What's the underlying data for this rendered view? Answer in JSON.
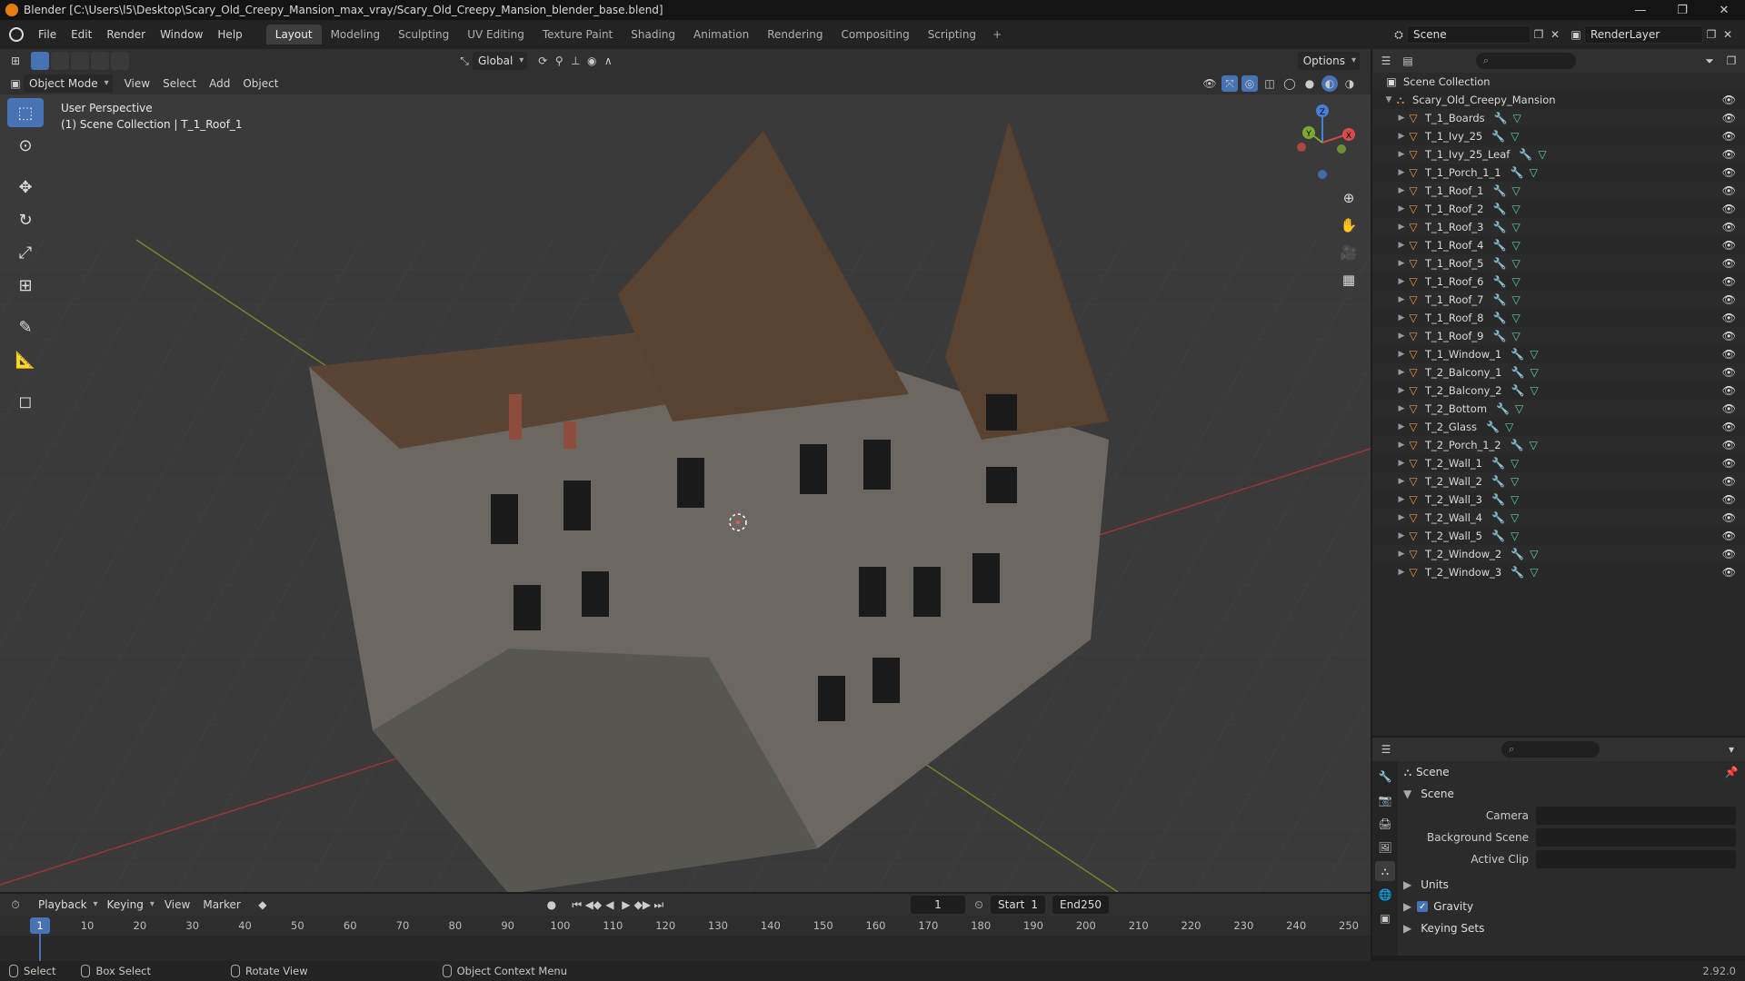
{
  "window": {
    "title": "Blender [C:\\Users\\l5\\Desktop\\Scary_Old_Creepy_Mansion_max_vray/Scary_Old_Creepy_Mansion_blender_base.blend]",
    "controls": [
      "—",
      "❐",
      "✕"
    ]
  },
  "menu": [
    "File",
    "Edit",
    "Render",
    "Window",
    "Help"
  ],
  "workspaces": [
    "Layout",
    "Modeling",
    "Sculpting",
    "UV Editing",
    "Texture Paint",
    "Shading",
    "Animation",
    "Rendering",
    "Compositing",
    "Scripting"
  ],
  "active_workspace": "Layout",
  "scene_selector": "Scene",
  "renderlayer_selector": "RenderLayer",
  "viewport_header": {
    "transform_orientation": "Global",
    "options_label": "Options",
    "mode": "Object Mode",
    "menus": [
      "View",
      "Select",
      "Add",
      "Object"
    ]
  },
  "viewport": {
    "perspective_label": "User Perspective",
    "context_label": "(1) Scene Collection | T_1_Roof_1",
    "axis_labels": {
      "x": "X",
      "y": "Y",
      "z": "Z"
    }
  },
  "outliner": {
    "root": "Scene Collection",
    "collection": "Scary_Old_Creepy_Mansion",
    "objects": [
      "T_1_Boards",
      "T_1_Ivy_25",
      "T_1_Ivy_25_Leaf",
      "T_1_Porch_1_1",
      "T_1_Roof_1",
      "T_1_Roof_2",
      "T_1_Roof_3",
      "T_1_Roof_4",
      "T_1_Roof_5",
      "T_1_Roof_6",
      "T_1_Roof_7",
      "T_1_Roof_8",
      "T_1_Roof_9",
      "T_1_Window_1",
      "T_2_Balcony_1",
      "T_2_Balcony_2",
      "T_2_Bottom",
      "T_2_Glass",
      "T_2_Porch_1_2",
      "T_2_Wall_1",
      "T_2_Wall_2",
      "T_2_Wall_3",
      "T_2_Wall_4",
      "T_2_Wall_5",
      "T_2_Window_2",
      "T_2_Window_3"
    ]
  },
  "properties": {
    "header": "Scene",
    "panel": "Scene",
    "fields": [
      {
        "label": "Camera"
      },
      {
        "label": "Background Scene"
      },
      {
        "label": "Active Clip"
      }
    ],
    "collapsed_panels": [
      "Units",
      "Gravity",
      "Keying Sets"
    ],
    "gravity_checked": true
  },
  "timeline": {
    "menus": [
      "Playback",
      "Keying",
      "View",
      "Marker"
    ],
    "current_frame": "1",
    "start_label": "Start",
    "start_value": "1",
    "end_label": "End",
    "end_value": "250",
    "ticks": [
      "1",
      "10",
      "20",
      "30",
      "40",
      "50",
      "60",
      "70",
      "80",
      "90",
      "100",
      "110",
      "120",
      "130",
      "140",
      "150",
      "160",
      "170",
      "180",
      "190",
      "200",
      "210",
      "220",
      "230",
      "240",
      "250"
    ]
  },
  "statusbar": {
    "items": [
      "Select",
      "Box Select",
      "Rotate View",
      "Object Context Menu"
    ],
    "version": "2.92.0"
  }
}
